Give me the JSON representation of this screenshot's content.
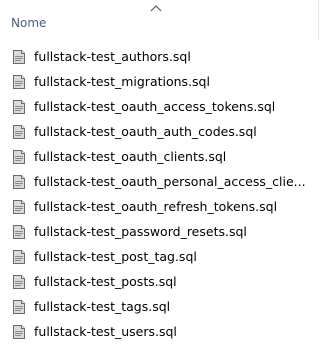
{
  "header": {
    "column_label": "Nome",
    "sort_icon": "chevron-up-icon"
  },
  "files": [
    {
      "name": "fullstack-test_authors.sql",
      "icon": "sql-file-icon"
    },
    {
      "name": "fullstack-test_migrations.sql",
      "icon": "sql-file-icon"
    },
    {
      "name": "fullstack-test_oauth_access_tokens.sql",
      "icon": "sql-file-icon"
    },
    {
      "name": "fullstack-test_oauth_auth_codes.sql",
      "icon": "sql-file-icon"
    },
    {
      "name": "fullstack-test_oauth_clients.sql",
      "icon": "sql-file-icon"
    },
    {
      "name": "fullstack-test_oauth_personal_access_clie...",
      "icon": "sql-file-icon"
    },
    {
      "name": "fullstack-test_oauth_refresh_tokens.sql",
      "icon": "sql-file-icon"
    },
    {
      "name": "fullstack-test_password_resets.sql",
      "icon": "sql-file-icon"
    },
    {
      "name": "fullstack-test_post_tag.sql",
      "icon": "sql-file-icon"
    },
    {
      "name": "fullstack-test_posts.sql",
      "icon": "sql-file-icon"
    },
    {
      "name": "fullstack-test_tags.sql",
      "icon": "sql-file-icon"
    },
    {
      "name": "fullstack-test_users.sql",
      "icon": "sql-file-icon"
    }
  ]
}
